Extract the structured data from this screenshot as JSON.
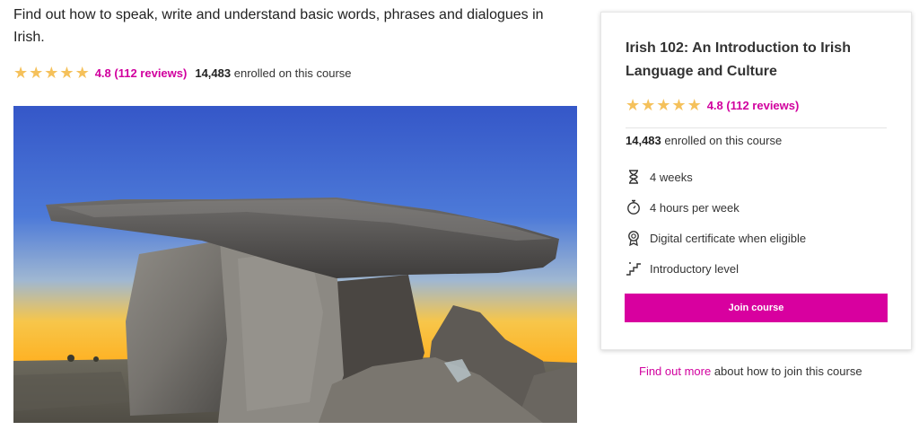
{
  "intro": {
    "description": "Find out how to speak, write and understand basic words, phrases and dialogues in Irish."
  },
  "rating": {
    "stars": 5,
    "score_text": "4.8 (112 reviews)"
  },
  "enrollment": {
    "count": "14,483",
    "suffix": "enrolled on this course"
  },
  "hero": {
    "image_description_icon": "dolmen-photo"
  },
  "card": {
    "title": "Irish 102: An Introduction to Irish Language and Culture",
    "rating_text": "4.8 (112 reviews)",
    "enrolled_count": "14,483",
    "enrolled_suffix": "enrolled on this course",
    "facts": [
      {
        "icon": "hourglass-icon",
        "label": "4 weeks"
      },
      {
        "icon": "stopwatch-icon",
        "label": "4 hours per week"
      },
      {
        "icon": "certificate-icon",
        "label": "Digital certificate when eligible"
      },
      {
        "icon": "steps-icon",
        "label": "Introductory level"
      }
    ],
    "join_label": "Join course"
  },
  "find_out": {
    "link": "Find out more",
    "rest": " about how to join this course"
  },
  "colors": {
    "accent": "#d8009f",
    "star": "#f5c15b"
  }
}
